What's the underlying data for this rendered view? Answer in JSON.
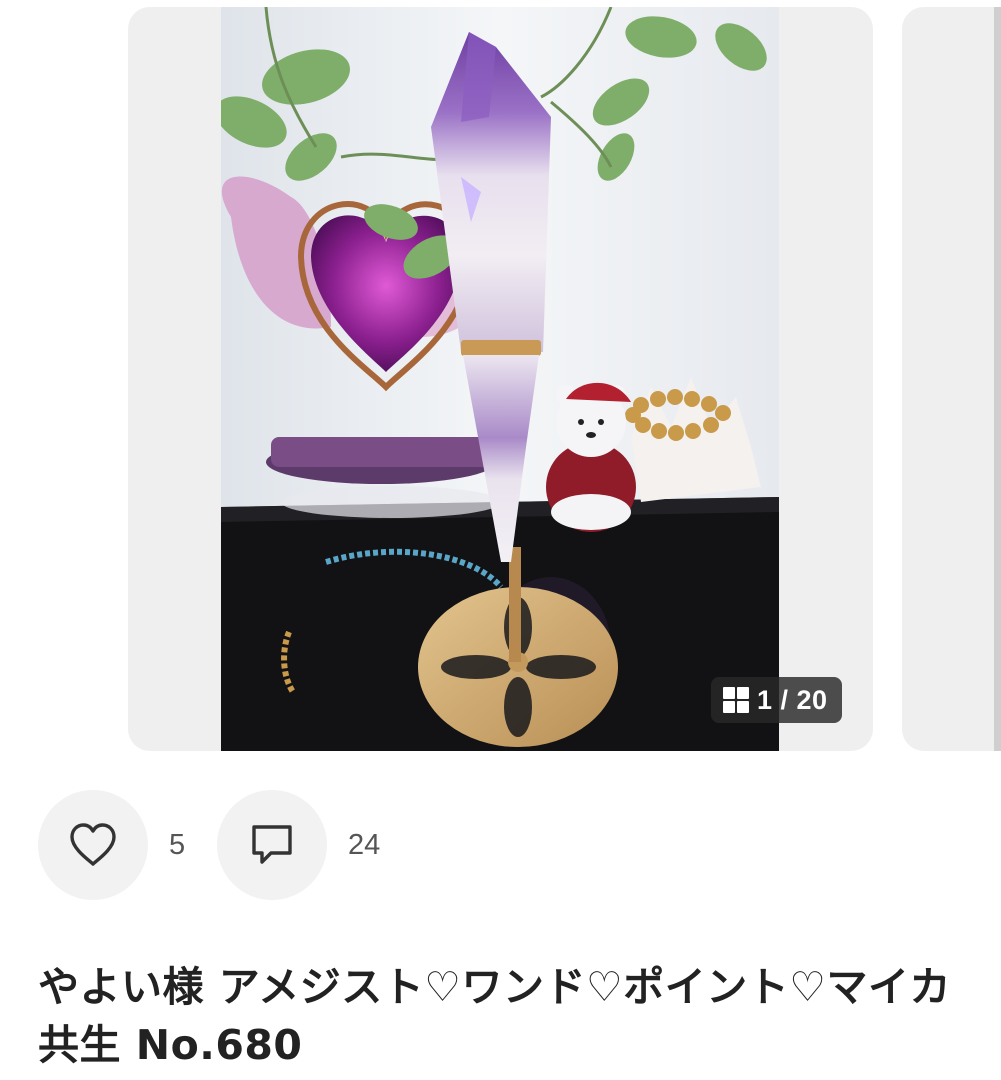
{
  "gallery": {
    "counter_text": "1 / 20",
    "current": 1,
    "total": 20
  },
  "photo_alt": "アメジスト ワンド ポイント",
  "actions": {
    "like_count": "5",
    "comment_count": "24"
  },
  "item": {
    "title": "やよい様 アメジスト♡ワンド♡ポイント♡マイカ共生 No.680"
  },
  "colors": {
    "card_bg": "#efefef",
    "button_bg": "#f2f2f2",
    "counter_bg": "#282828",
    "title_text": "#222222",
    "count_text": "#555555"
  },
  "icons": {
    "like": "heart-outline-icon",
    "comment": "speech-bubble-icon",
    "gallery": "grid-icon"
  }
}
